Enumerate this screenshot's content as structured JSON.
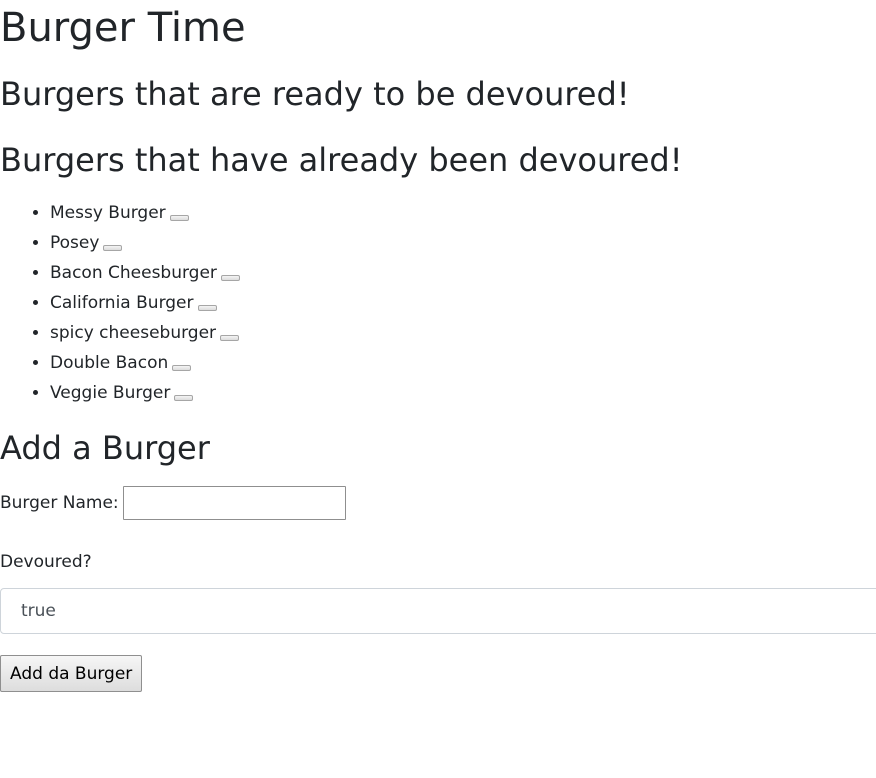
{
  "page": {
    "title": "Burger Time"
  },
  "ready_section": {
    "heading": "Burgers that are ready to be devoured!"
  },
  "devoured_section": {
    "heading": "Burgers that have already been devoured!",
    "items": [
      {
        "name": "Messy Burger"
      },
      {
        "name": "Posey"
      },
      {
        "name": "Bacon Cheesburger"
      },
      {
        "name": "California Burger"
      },
      {
        "name": "spicy cheeseburger"
      },
      {
        "name": "Double Bacon"
      },
      {
        "name": "Veggie Burger"
      }
    ]
  },
  "add_form": {
    "heading": "Add a Burger",
    "name_label": "Burger Name:",
    "name_value": "",
    "devoured_label": "Devoured?",
    "devoured_selected": "true",
    "submit_label": "Add da Burger"
  }
}
